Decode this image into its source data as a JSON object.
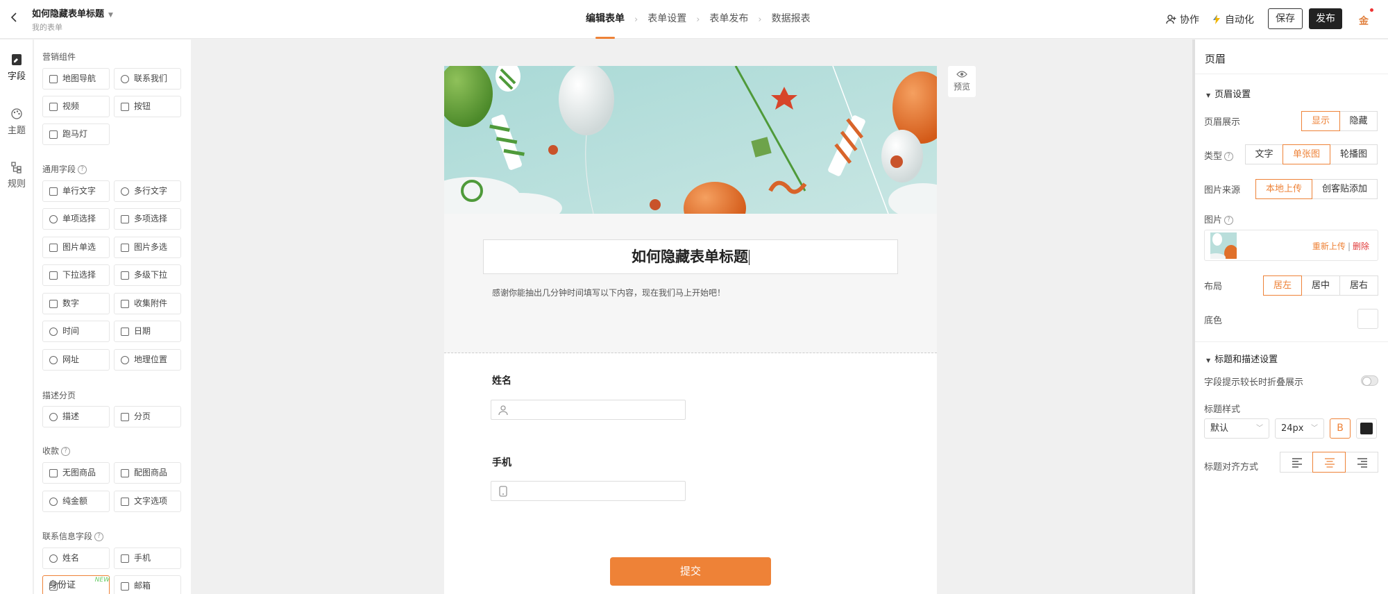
{
  "topbar": {
    "form_title": "如何隐藏表单标题",
    "breadcrumb": "我的表单",
    "steps": [
      "编辑表单",
      "表单设置",
      "表单发布",
      "数据报表"
    ],
    "collab": "协作",
    "automation": "自动化",
    "save": "保存",
    "publish": "发布",
    "user_logo": "金",
    "accent": "#ee8237"
  },
  "left_nav": [
    {
      "label": "字段",
      "icon": "field-icon"
    },
    {
      "label": "主题",
      "icon": "palette-icon"
    },
    {
      "label": "规则",
      "icon": "rules-icon"
    }
  ],
  "components": {
    "marketing": {
      "title": "营销组件",
      "items": [
        {
          "label": "地图导航",
          "icon": "map-icon"
        },
        {
          "label": "联系我们",
          "icon": "phone-icon"
        },
        {
          "label": "视频",
          "icon": "video-icon"
        },
        {
          "label": "按钮",
          "icon": "button-icon"
        },
        {
          "label": "跑马灯",
          "icon": "marquee-icon"
        }
      ]
    },
    "general": {
      "title": "通用字段",
      "items": [
        {
          "label": "单行文字",
          "icon": "text-icon"
        },
        {
          "label": "多行文字",
          "icon": "multiline-icon"
        },
        {
          "label": "单项选择",
          "icon": "radio-icon"
        },
        {
          "label": "多项选择",
          "icon": "checkbox-icon"
        },
        {
          "label": "图片单选",
          "icon": "image-radio-icon"
        },
        {
          "label": "图片多选",
          "icon": "image-multi-icon"
        },
        {
          "label": "下拉选择",
          "icon": "dropdown-icon"
        },
        {
          "label": "多级下拉",
          "icon": "cascade-icon"
        },
        {
          "label": "数字",
          "icon": "number-icon"
        },
        {
          "label": "收集附件",
          "icon": "upload-icon"
        },
        {
          "label": "时间",
          "icon": "clock-icon"
        },
        {
          "label": "日期",
          "icon": "calendar-icon"
        },
        {
          "label": "网址",
          "icon": "link-icon"
        },
        {
          "label": "地理位置",
          "icon": "location-icon"
        }
      ]
    },
    "pages": {
      "title": "描述分页",
      "items": [
        {
          "label": "描述",
          "icon": "info-icon"
        },
        {
          "label": "分页",
          "icon": "pagebreak-icon"
        }
      ]
    },
    "payment": {
      "title": "收款",
      "items": [
        {
          "label": "无图商品",
          "icon": "cart-icon"
        },
        {
          "label": "配图商品",
          "icon": "cart-image-icon"
        },
        {
          "label": "纯金额",
          "icon": "yen-icon"
        },
        {
          "label": "文字选项",
          "icon": "text-option-icon"
        }
      ]
    },
    "contact": {
      "title": "联系信息字段",
      "items": [
        {
          "label": "姓名",
          "icon": "person-icon"
        },
        {
          "label": "手机",
          "icon": "mobile-icon"
        },
        {
          "label": "身份证",
          "icon": "idcard-icon",
          "badge": "NEW"
        },
        {
          "label": "邮箱",
          "icon": "mail-icon"
        }
      ]
    }
  },
  "form": {
    "title": "如何隐藏表单标题",
    "description": "感谢你能抽出几分钟时间填写以下内容，现在我们马上开始吧！",
    "fields": [
      {
        "label": "姓名",
        "icon": "person-icon"
      },
      {
        "label": "手机",
        "icon": "mobile-icon"
      }
    ],
    "submit": "提交",
    "preview": "预览"
  },
  "settings": {
    "panel_title": "页眉",
    "header_section": "页眉设置",
    "display_label": "页眉展示",
    "display_options": [
      "显示",
      "隐藏"
    ],
    "type_label": "类型",
    "type_options": [
      "文字",
      "单张图",
      "轮播图"
    ],
    "source_label": "图片来源",
    "source_options": [
      "本地上传",
      "创客贴添加"
    ],
    "image_label": "图片",
    "reupload": "重新上传",
    "divider": "|",
    "delete": "删除",
    "layout_label": "布局",
    "layout_options": [
      "居左",
      "居中",
      "居右"
    ],
    "bg_label": "底色",
    "title_section": "标题和描述设置",
    "collapse_label": "字段提示较长时折叠展示",
    "title_style_label": "标题样式",
    "font_value": "默认",
    "size_value": "24px",
    "bold_glyph": "B",
    "title_color": "#222222",
    "align_label": "标题对齐方式"
  }
}
